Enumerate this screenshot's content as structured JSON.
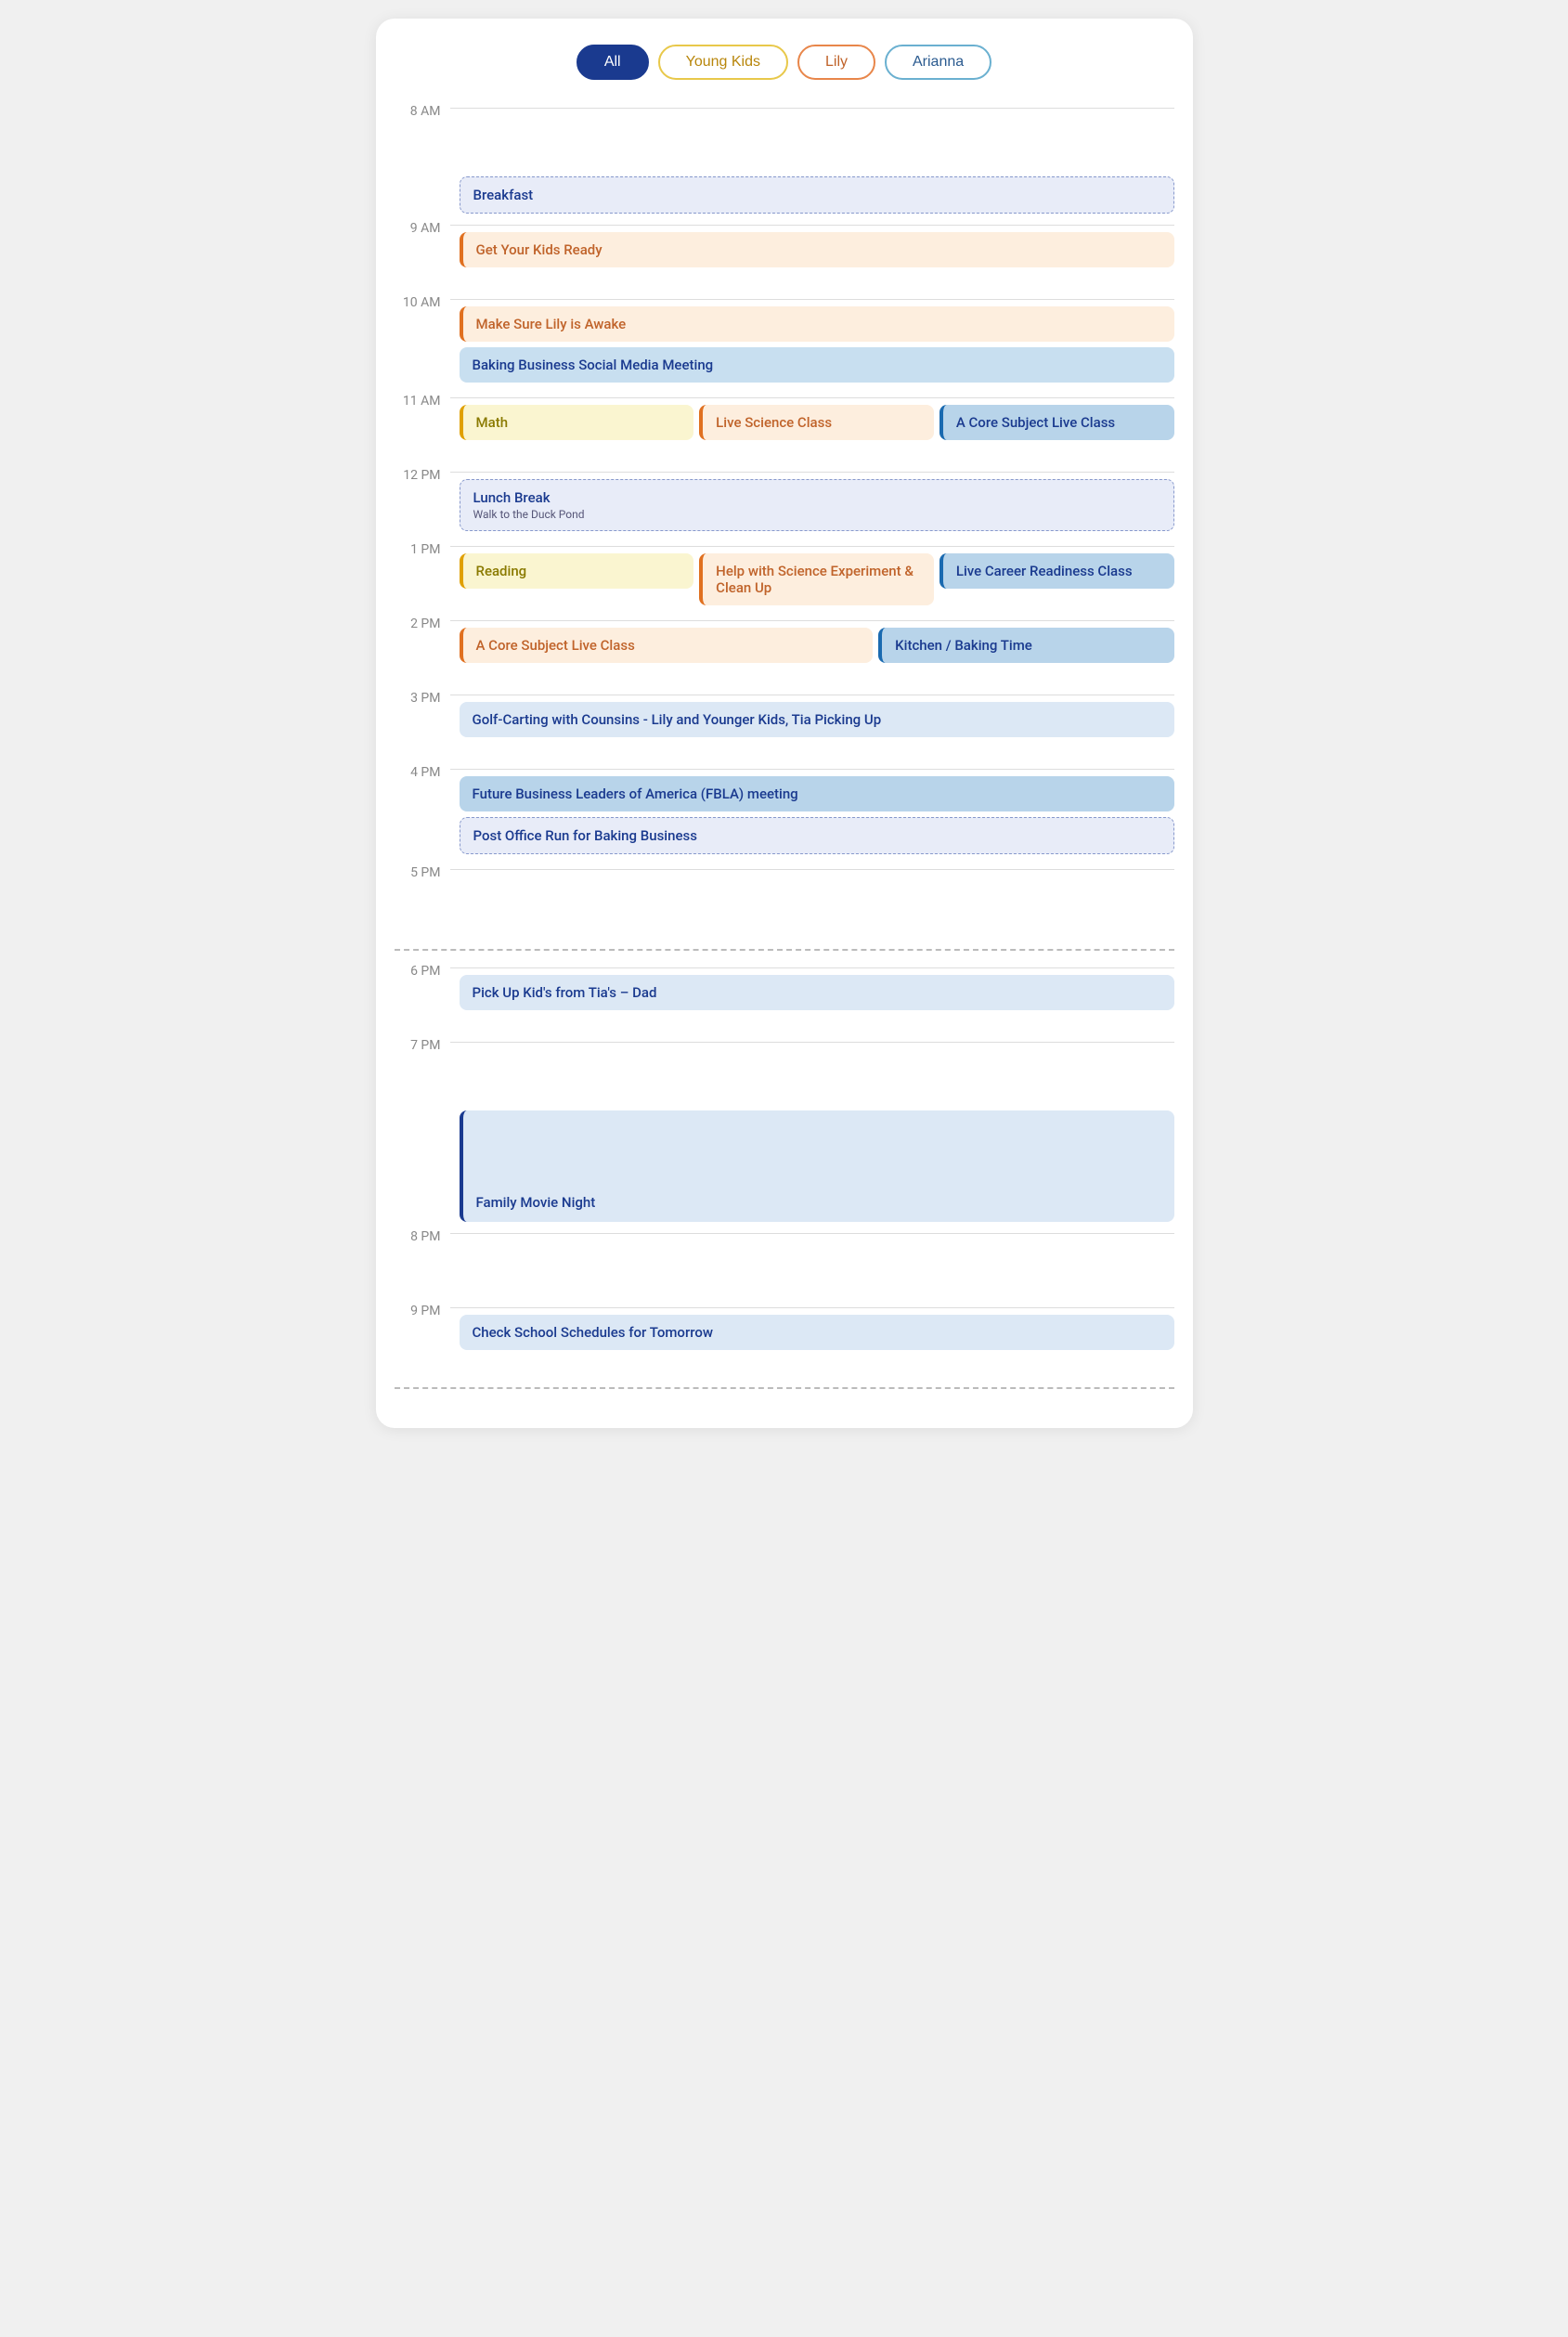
{
  "filters": {
    "tabs": [
      {
        "id": "all",
        "label": "All",
        "style": "active-all"
      },
      {
        "id": "young",
        "label": "Young Kids",
        "style": "active-young"
      },
      {
        "id": "lily",
        "label": "Lily",
        "style": "active-lily"
      },
      {
        "id": "arianna",
        "label": "Arianna",
        "style": "active-arianna"
      }
    ]
  },
  "times": {
    "8am": "8 AM",
    "9am": "9 AM",
    "10am": "10 AM",
    "11am": "11 AM",
    "12pm": "12 PM",
    "1pm": "1 PM",
    "2pm": "2 PM",
    "3pm": "3 PM",
    "4pm": "4 PM",
    "5pm": "5 PM",
    "6pm": "6 PM",
    "7pm": "7 PM",
    "8pm": "8 PM",
    "9pm": "9 PM"
  },
  "events": {
    "breakfast": "Breakfast",
    "get_ready": "Get Your Kids Ready",
    "lily_awake": "Make Sure Lily is Awake",
    "baking_meeting": "Baking Business Social Media Meeting",
    "math": "Math",
    "live_science": "Live Science Class",
    "core_subject_1": "A Core Subject Live Class",
    "lunch_title": "Lunch Break",
    "lunch_sub": "Walk to the Duck Pond",
    "reading": "Reading",
    "help_science": "Help with Science Experiment & Clean Up",
    "live_career": "Live Career Readiness Class",
    "core_subject_2": "A Core Subject Live Class",
    "kitchen_baking": "Kitchen / Baking Time",
    "golf_carting": "Golf-Carting with Counsins - Lily and Younger Kids, Tia Picking Up",
    "fbla": "Future Business Leaders of America (FBLA) meeting",
    "post_office": "Post Office Run for Baking Business",
    "pickup": "Pick Up Kid's from Tia's – Dad",
    "family_movie": "Family Movie Night",
    "check_school": "Check School Schedules for Tomorrow"
  }
}
